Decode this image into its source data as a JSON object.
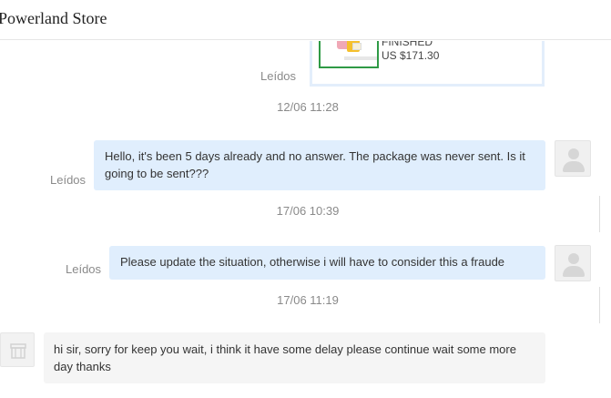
{
  "header": {
    "title": "Powerland Store"
  },
  "order_card": {
    "status": "FINISHED",
    "price": "US $171.30"
  },
  "messages": [
    {
      "read_label": "Leídos",
      "timestamp": "12/06 11:28"
    },
    {
      "read_label": "Leídos",
      "text": "Hello, it's been 5 days already and no answer. The package was never sent. Is it going to be sent???",
      "timestamp": "17/06 10:39"
    },
    {
      "read_label": "Leídos",
      "text": "Please update the situation, otherwise i will have to consider this  a fraude",
      "timestamp": "17/06 11:19"
    },
    {
      "text": "hi sir, sorry for keep you wait, i think it have some delay please continue wait some more day thanks"
    }
  ],
  "icons": {
    "user_avatar": "user-silhouette-icon",
    "store_avatar": "store-icon"
  },
  "colors": {
    "outgoing_bubble": "#e0eefd",
    "incoming_bubble": "#f5f5f5",
    "order_thumb_border": "#2f9a45",
    "muted_text": "#8a8a8a"
  }
}
